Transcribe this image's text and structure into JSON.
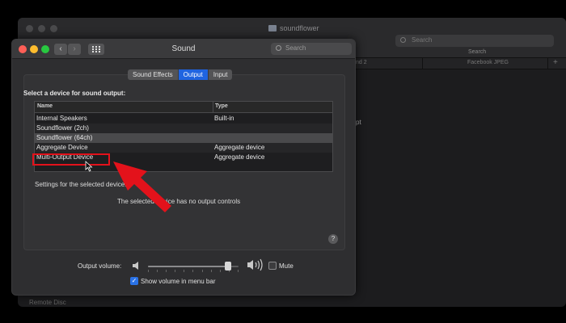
{
  "finder": {
    "title": "soundflower",
    "search_placeholder": "Search",
    "search_caption": "Search",
    "columns": [
      "nd 2",
      "Facebook JPEG"
    ],
    "add_label": "+",
    "content_fragment": "pt",
    "sidebar_fragment": "Remote Disc"
  },
  "sound_window": {
    "title": "Sound",
    "search_placeholder": "Search",
    "tabs": [
      {
        "label": "Sound Effects",
        "active": false
      },
      {
        "label": "Output",
        "active": true
      },
      {
        "label": "Input",
        "active": false
      }
    ],
    "select_label": "Select a device for sound output:",
    "table": {
      "headers": {
        "name": "Name",
        "type": "Type"
      },
      "rows": [
        {
          "name": "Internal Speakers",
          "type": "Built-in"
        },
        {
          "name": "Soundflower (2ch)",
          "type": ""
        },
        {
          "name": "Soundflower (64ch)",
          "type": ""
        },
        {
          "name": "Aggregate Device",
          "type": "Aggregate device"
        },
        {
          "name": "Multi-Output Device",
          "type": "Aggregate device"
        }
      ],
      "selected_row": 2
    },
    "settings_label": "Settings for the selected device:",
    "no_controls": "The selected device has no output controls",
    "help": "?",
    "output_volume_label": "Output volume:",
    "volume_level": 0.88,
    "mute_label": "Mute",
    "mute_checked": false,
    "show_volume_label": "Show volume in menu bar",
    "show_volume_checked": true
  },
  "annotation": {
    "highlight_color": "#e3121b",
    "arrow_color": "#e3121b"
  },
  "colors": {
    "accent": "#1f64e0",
    "window_bg": "#2e2e30"
  }
}
